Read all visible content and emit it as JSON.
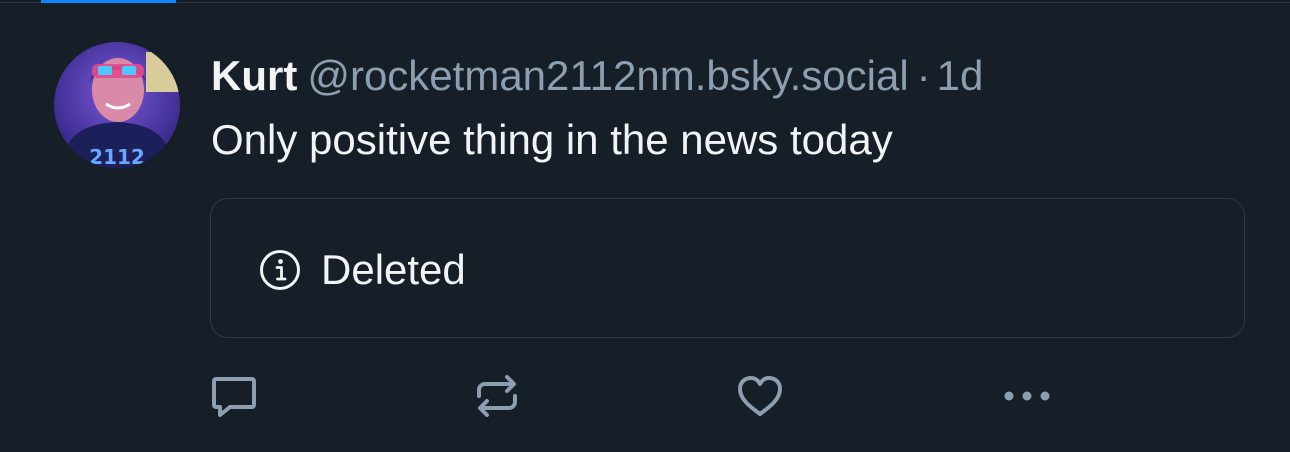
{
  "post": {
    "author_name": "Kurt",
    "handle": "@rocketman2112nm.bsky.social",
    "separator": "·",
    "timestamp": "1d",
    "text": "Only positive thing in the news today",
    "quote": {
      "icon": "info-icon",
      "label": "Deleted"
    },
    "actions": [
      {
        "name": "reply",
        "icon": "speech-bubble-icon"
      },
      {
        "name": "repost",
        "icon": "repost-arrows-icon"
      },
      {
        "name": "like",
        "icon": "heart-icon"
      },
      {
        "name": "more",
        "icon": "ellipsis-icon"
      }
    ]
  },
  "colors": {
    "background": "#161e27",
    "border": "#2e3a48",
    "text_primary": "#f1f3f5",
    "text_secondary": "#8d9eb1",
    "accent": "#1083fe"
  }
}
